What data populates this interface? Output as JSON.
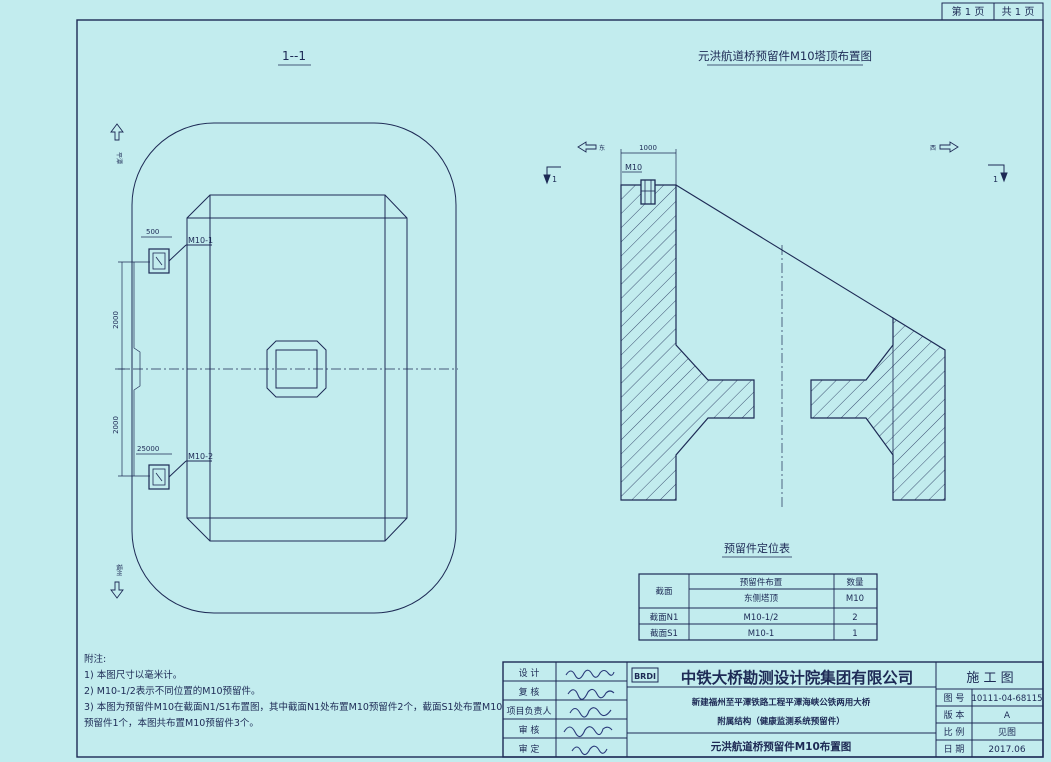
{
  "page_counter": {
    "page": "第 1 页",
    "total": "共 1 页"
  },
  "left_view": {
    "title": "1--1",
    "label_top": "平潭",
    "label_bottom": "福州",
    "dims": [
      "500",
      "2000",
      "2000",
      "25000"
    ],
    "labels": [
      "M10-1",
      "M10-2"
    ]
  },
  "right_view": {
    "title": "元洪航道桥预留件M10塔顶布置图",
    "east_label": "东",
    "west_label": "西",
    "dim_top": "1000",
    "label_m10": "M10",
    "section_mark": "1"
  },
  "table": {
    "title": "预留件定位表",
    "head_section": "截面",
    "head_layout": "预留件布置",
    "head_qty": "数量",
    "sub_location": "东侧塔顶",
    "sub_code": "M10",
    "rows": [
      {
        "section": "截面N1",
        "layout": "M10-1/2",
        "qty": "2"
      },
      {
        "section": "截面S1",
        "layout": "M10-1",
        "qty": "1"
      }
    ]
  },
  "notes": {
    "title": "附注:",
    "items": [
      "1) 本图尺寸以毫米计。",
      "2) M10-1/2表示不同位置的M10预留件。",
      "3) 本图为预留件M10在截面N1/S1布置图，其中截面N1处布置M10预留件2个，截面S1处布置M10预留件1个，本图共布置M10预留件3个。"
    ]
  },
  "title_block": {
    "roles": [
      "设 计",
      "复 核",
      "项目负责人",
      "审 核",
      "审 定"
    ],
    "logo": "BRDI",
    "company": "中铁大桥勘测设计院集团有限公司",
    "project_line1": "新建福州至平潭铁路工程平潭海峡公铁两用大桥",
    "project_line2": "附属结构（健康监测系统预留件）",
    "drawing_title": "元洪航道桥预留件M10布置图",
    "stage": "施 工 图",
    "fields": [
      {
        "label": "图 号",
        "value": "10111-04-68115"
      },
      {
        "label": "版 本",
        "value": "A"
      },
      {
        "label": "比 例",
        "value": "见图"
      },
      {
        "label": "日 期",
        "value": "2017.06"
      }
    ]
  }
}
